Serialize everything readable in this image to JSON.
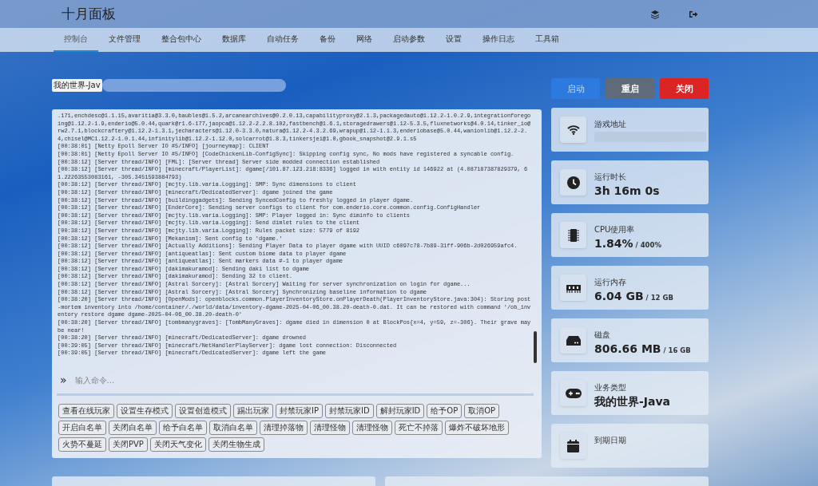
{
  "header": {
    "title": "十月面板"
  },
  "nav": [
    {
      "label": "控制台",
      "selected": true
    },
    {
      "label": "文件管理",
      "selected": false
    },
    {
      "label": "整合包中心",
      "selected": false
    },
    {
      "label": "数据库",
      "selected": false
    },
    {
      "label": "自动任务",
      "selected": false
    },
    {
      "label": "备份",
      "selected": false
    },
    {
      "label": "网络",
      "selected": false
    },
    {
      "label": "启动参数",
      "selected": false
    },
    {
      "label": "设置",
      "selected": false
    },
    {
      "label": "操作日志",
      "selected": false
    },
    {
      "label": "工具箱",
      "selected": false
    }
  ],
  "server_name": "我的世界-Jav",
  "controls": [
    {
      "label": "启动",
      "kind": "start",
      "disabled": true
    },
    {
      "label": "重启",
      "kind": "restart",
      "disabled": false
    },
    {
      "label": "关闭",
      "kind": "stop",
      "disabled": false
    }
  ],
  "console": {
    "lines": [
      ".171,enchdesc@1.1.15,avaritia@3.3.0,baubles@1.5.2,arcanearchives@0.2.0.13,capabilityproxy@2.1.3,packagedauto@1.12.2-1.0.2.9,integrationforegoing@1.12.2-1.9,enderio@5.0.44,quark@r1.6-177,jaopca@1.12.2-2.2.8.102,fastbench@1.6.1,storagedrawers@1.12-5.3.5,fluxnetworks@4.0.14,tinker_io@rw2.7.1,blockcraftery@1.12.2-1.3.1,jecharacters@1.12.0-3.3.0,natura@1.12.2-4.3.2.69,wrapup@1.12-1.1.3,enderiobase@5.0.44,wanionlib@1.12.2-2.4,chisel@MC1.12.2-1.0.1.44,infinitylib@1.12.2-1.12.0,solcarrot@1.8.3,tinkersjei@1.0,gbook_snapshot@2.9.1.s5",
      "[00:38:01] [Netty Epoll Server IO #5/INFO] [journeymap]: CLIENT",
      "[00:38:01] [Netty Epoll Server IO #5/INFO] [CodeChickenLib-ConfigSync]: Skipping config sync, No mods have registered a syncable config.",
      "[00:38:12] [Server thread/INFO] [FML]: [Server thread] Server side modded connection established",
      "[00:38:12] [Server thread/INFO] [minecraft/PlayerList]: dgame[/101.87.123.218:8336] logged in with entity id 146922 at (4.087187387829379, 61.22263553083161, -305.3451593884793)",
      "[00:38:12] [Server thread/INFO] [mcjty.lib.varia.Logging]: SMP: Sync dimensions to client",
      "[00:38:12] [Server thread/INFO] [minecraft/DedicatedServer]: dgame joined the game",
      "[00:38:12] [Server thread/INFO] [buildinggadgets]: Sending SyncedConfig to freshly logged in player dgame.",
      "[00:38:12] [Server thread/INFO] [EnderCore]: Sending server configs to client for com.enderio.core.common.config.ConfigHandler",
      "[00:38:12] [Server thread/INFO] [mcjty.lib.varia.Logging]: SMP: Player logged in: Sync diminfo to clients",
      "[00:38:12] [Server thread/INFO] [mcjty.lib.varia.Logging]: Send dimlet rules to the client",
      "[00:38:12] [Server thread/INFO] [mcjty.lib.varia.Logging]: Rules packet size: 5779 of 8192",
      "[00:38:12] [Server thread/INFO] [Mekanism]: Sent config to 'dgame.'",
      "[00:38:12] [Server thread/INFO] [Actually Additions]: Sending Player Data to player dgame with UUID c6097c78-7b89-31ff-906b-2d026959afc4.",
      "[00:38:12] [Server thread/INFO] [antiqueatlas]: Sent custom biome data to player dgame",
      "[00:38:12] [Server thread/INFO] [antiqueatlas]: Sent markers data #-1 to player dgame",
      "[00:38:12] [Server thread/INFO] [dakimakuramod]: Sending daki list to dgame",
      "[00:38:12] [Server thread/INFO] [dakimakuramod]: Sending 32 to client.",
      "[00:38:12] [Server thread/INFO] [Astral Sorcery]: [Astral Sorcery] Waiting for server synchronization on login for dgame...",
      "[00:38:12] [Server thread/INFO] [Astral Sorcery]: [Astral Sorcery] Synchronizing baseline information to dgame",
      "[00:38:20] [Server thread/INFO] [OpenMods]: openblocks.common.PlayerInventoryStore.onPlayerDeath(PlayerInventoryStore.java:304): Storing post-mortem inventory into /home/container/./world/data/inventory-dgame-2025-04-06_00.38.20-death-0.dat. It can be restored with command '/ob_inventory restore dgame dgame-2025-04-06_00.38.20-death-0'",
      "[00:38:20] [Server thread/INFO] [tombmanygraves]: [TombManyGraves]: dgame died in dimension 0 at BlockPos{x=4, y=59, z=-306}. Their grave may be near!",
      "[00:38:20] [Server thread/INFO] [minecraft/DedicatedServer]: dgame drowned",
      "[00:39:05] [Server thread/INFO] [minecraft/NetHandlerPlayServer]: dgame lost connection: Disconnected",
      "[00:39:05] [Server thread/INFO] [minecraft/DedicatedServer]: dgame left the game"
    ],
    "prompt": "»",
    "placeholder": "输入命令..."
  },
  "quick_commands": [
    "查看在线玩家",
    "设置生存模式",
    "设置创造模式",
    "踢出玩家",
    "封禁玩家IP",
    "封禁玩家ID",
    "解封玩家ID",
    "给予OP",
    "取消OP",
    "开启白名单",
    "关闭白名单",
    "给予白名单",
    "取消白名单",
    "清理掉落物",
    "清理怪物",
    "清理怪物",
    "死亡不掉落",
    "爆炸不破坏地形",
    "火势不蔓延",
    "关闭PVP",
    "关闭天气变化",
    "关闭生物生成"
  ],
  "stats": [
    {
      "kind": "address",
      "label": "游戏地址"
    },
    {
      "kind": "uptime",
      "label": "运行时长",
      "value": "3h 16m 0s"
    },
    {
      "kind": "cpu",
      "label": "CPU使用率",
      "value": "1.84%",
      "total": "/ 400%"
    },
    {
      "kind": "memory",
      "label": "运行内存",
      "value": "6.04 GB",
      "total": "/ 12 GB"
    },
    {
      "kind": "disk",
      "label": "磁盘",
      "value": "806.66 MB",
      "total": "/ 16 GB"
    },
    {
      "kind": "type",
      "label": "业务类型",
      "value": "我的世界-Java"
    },
    {
      "kind": "expiry",
      "label": "到期日期"
    }
  ]
}
